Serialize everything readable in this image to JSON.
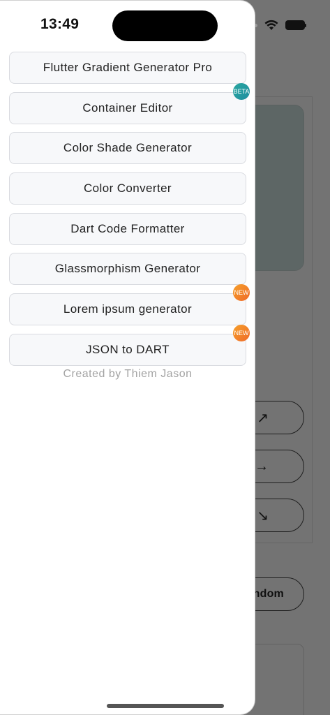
{
  "status_bar": {
    "time": "13:49"
  },
  "drawer": {
    "menu": [
      {
        "label": "Flutter Gradient Generator Pro",
        "badge": ""
      },
      {
        "label": "Container Editor",
        "badge": "BETA"
      },
      {
        "label": "Color Shade Generator",
        "badge": ""
      },
      {
        "label": "Color Converter",
        "badge": ""
      },
      {
        "label": "Dart Code Formatter",
        "badge": ""
      },
      {
        "label": "Glassmorphism Generator",
        "badge": ""
      },
      {
        "label": "Lorem ipsum generator",
        "badge": "NEW"
      },
      {
        "label": "JSON to DART",
        "badge": "NEW"
      }
    ],
    "credit": "Created by Thiem Jason"
  },
  "background": {
    "direction_buttons": [
      {
        "arrow": "↗"
      },
      {
        "arrow": "→"
      },
      {
        "arrow": "↘"
      }
    ],
    "random_button": "ndom"
  },
  "colors": {
    "scrim": "#000000",
    "beta_badge": "#2aa7a0",
    "new_badge": "#f08a2a",
    "menu_item_bg": "#f7f8fa"
  }
}
